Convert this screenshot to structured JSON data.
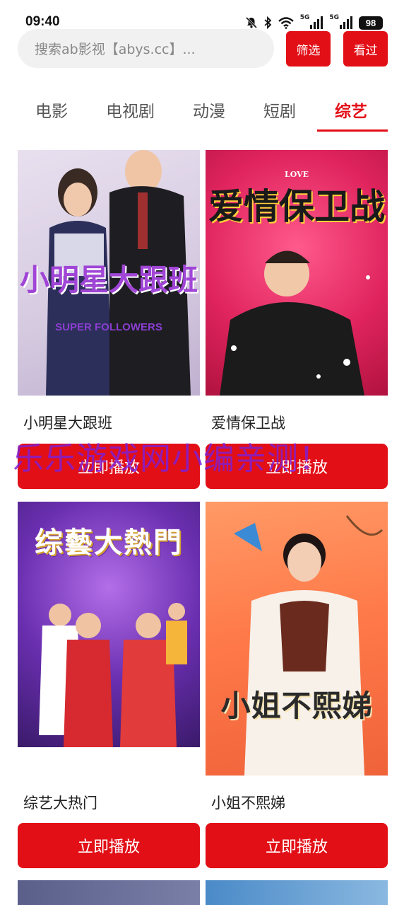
{
  "status_bar": {
    "time": "09:40",
    "network_a": "5G",
    "network_b": "5G",
    "battery": "98"
  },
  "search": {
    "placeholder": "搜索ab影视【abys.cc】..."
  },
  "header": {
    "filter_label": "筛选",
    "history_label": "看过"
  },
  "tabs": [
    {
      "label": "电影",
      "active": false
    },
    {
      "label": "电视剧",
      "active": false
    },
    {
      "label": "动漫",
      "active": false
    },
    {
      "label": "短剧",
      "active": false
    },
    {
      "label": "综艺",
      "active": true
    }
  ],
  "cards": [
    {
      "title": "小明星大跟班",
      "poster_title": "小明星大跟班",
      "poster_subtitle": "SUPER FOLLOWERS",
      "play_label": "立即播放"
    },
    {
      "title": "爱情保卫战",
      "poster_title": "爱情保卫战",
      "poster_subtitle": "LOVE",
      "play_label": "立即播放"
    },
    {
      "title": "综艺大热门",
      "poster_title": "综藝大熱門",
      "play_label": "立即播放"
    },
    {
      "title": "小姐不熙娣",
      "poster_title": "小姐不熙娣",
      "play_label": "立即播放"
    }
  ],
  "watermark": "乐乐游戏网小编亲测！",
  "colors": {
    "accent": "#e20f17",
    "watermark": "#7f1fd8"
  }
}
